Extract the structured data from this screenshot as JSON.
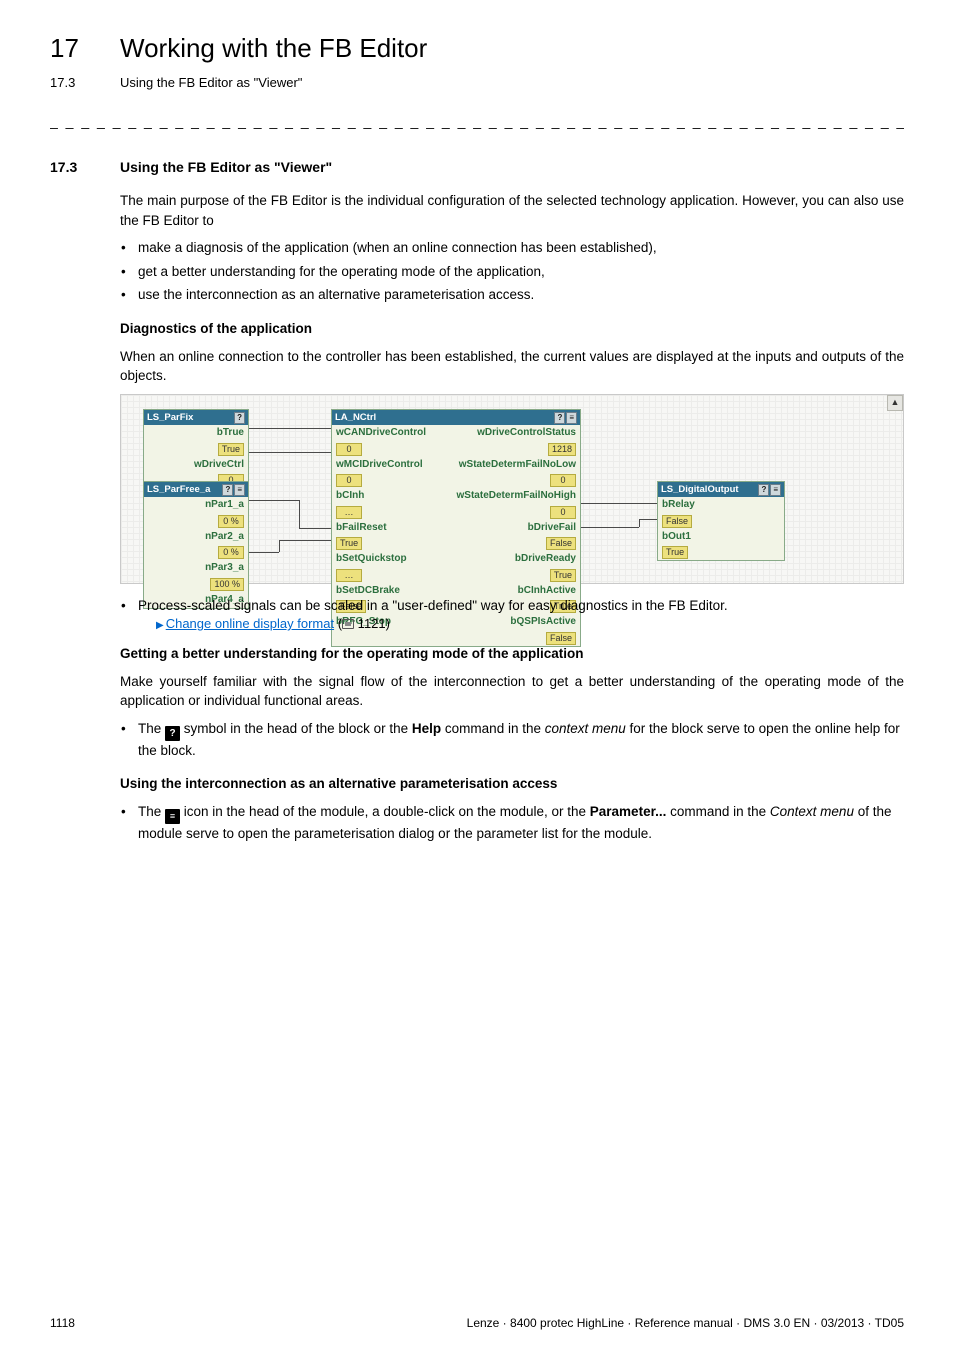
{
  "chapter": {
    "number": "17",
    "title": "Working with the FB Editor"
  },
  "subline": {
    "number": "17.3",
    "title": "Using the FB Editor as \"Viewer\""
  },
  "section": {
    "number": "17.3",
    "title": "Using the FB Editor as \"Viewer\""
  },
  "intro": "The main purpose of the FB Editor is the individual configuration of the selected technology application. However, you can also use the FB Editor to",
  "intro_bullets": [
    "make a diagnosis of the application (when an online connection has been established),",
    "get a better understanding for the operating mode of the application,",
    "use the interconnection as an alternative parameterisation access."
  ],
  "diag_head": "Diagnostics of the application",
  "diag_para": "When an online connection to the controller has been established, the current values are displayed at the inputs and outputs of the objects.",
  "process_bullet": "Process-scaled signals can be scaled in a \"user-defined\" way for easy diagnostics in the FB Editor.",
  "link_text": "Change online display format",
  "link_page": " 1121)",
  "better_head": "Getting a better understanding for the operating mode of the application",
  "better_para": "Make yourself familiar with the signal flow of the interconnection to get a better understanding of the operating mode of the application or individual functional areas.",
  "help_bullet_a": "The ",
  "help_bullet_b": " symbol in the head of the block or the ",
  "help_bullet_bold1": "Help",
  "help_bullet_c": " command in the ",
  "help_bullet_italic": "context menu",
  "help_bullet_d": " for the block serve to open the online help for the block.",
  "help_icon_char": "?",
  "inter_head": "Using the interconnection as an alternative parameterisation access",
  "param_bullet_a": "The ",
  "param_bullet_b": " icon in the head of the module, a double-click on the module, or the ",
  "param_bullet_bold": "Parameter...",
  "param_bullet_c": " command in the ",
  "param_bullet_ital": "Context menu",
  "param_bullet_d": " of the module serve to open the parameterisation dialog or the parameter list for the module.",
  "param_icon_char": "≡",
  "footer": {
    "page": "1118",
    "meta": "Lenze · 8400 protec HighLine · Reference manual · DMS 3.0 EN · 03/2013 · TD05"
  },
  "diagram": {
    "parfix": {
      "title": "LS_ParFix",
      "rows": [
        {
          "left": "bTrue",
          "right": ""
        },
        {
          "left": "True",
          "right": ""
        },
        {
          "left": "wDriveCtrl",
          "right": ""
        },
        {
          "left": "0",
          "right": ""
        }
      ]
    },
    "parfree": {
      "title": "LS_ParFree_a",
      "rows": [
        {
          "left": "nPar1_a",
          "right": ""
        },
        {
          "left": "0 %",
          "right": ""
        },
        {
          "left": "nPar2_a",
          "right": ""
        },
        {
          "left": "0 %",
          "right": ""
        },
        {
          "left": "nPar3_a",
          "right": ""
        },
        {
          "left": "100 %",
          "right": ""
        },
        {
          "left": "nPar4_a",
          "right": ""
        }
      ]
    },
    "nctrl": {
      "title": "LA_NCtrl",
      "rows": [
        {
          "left": "wCANDriveControl",
          "right": "wDriveControlStatus"
        },
        {
          "left": "0",
          "right": "1218"
        },
        {
          "left": "wMCIDriveControl",
          "right": "wStateDetermFailNoLow"
        },
        {
          "left": "0",
          "right": "0"
        },
        {
          "left": "bCInh",
          "right": "wStateDetermFailNoHigh"
        },
        {
          "left": "…",
          "right": "0"
        },
        {
          "left": "bFailReset",
          "right": "bDriveFail"
        },
        {
          "left": "True",
          "right": "False"
        },
        {
          "left": "bSetQuickstop",
          "right": "bDriveReady"
        },
        {
          "left": "…",
          "right": "True"
        },
        {
          "left": "bSetDCBrake",
          "right": "bCInhActive"
        },
        {
          "left": "False",
          "right": "True"
        },
        {
          "left": "bRFG_Stop",
          "right": "bQSPIsActive"
        },
        {
          "left": "",
          "right": "False"
        }
      ]
    },
    "digout": {
      "title": "LS_DigitalOutput",
      "rows": [
        {
          "left": "bRelay",
          "right": ""
        },
        {
          "left": "False",
          "right": ""
        },
        {
          "left": "bOut1",
          "right": ""
        },
        {
          "left": "True",
          "right": ""
        }
      ]
    }
  }
}
